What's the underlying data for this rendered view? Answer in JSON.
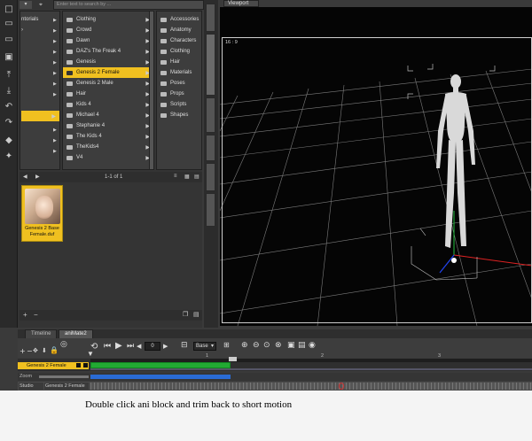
{
  "search": {
    "placeholder": "Enter text to search by ..."
  },
  "library": {
    "col1": [
      "ntorials",
      ""
    ],
    "col2": [
      "Clothing",
      "Crowd",
      "Dawn",
      "DAZ's The Freak 4",
      "Genesis",
      "Genesis 2 Female",
      "Genesis 2 Male",
      "Hair",
      "Kids 4",
      "Michael 4",
      "Stephanie 4",
      "The Kids 4",
      "TheKids4",
      "V4"
    ],
    "col2_selected": "Genesis 2 Female",
    "col3": [
      "Accessories",
      "Anatomy",
      "Characters",
      "Clothing",
      "Hair",
      "Materials",
      "Poses",
      "Props",
      "Scripts",
      "Shapes"
    ],
    "pager": "1-1 of 1",
    "thumb_label": "Genesis 2 Base Female.duf"
  },
  "side_tabs": [
    "Smart",
    "Content Library",
    "Posing",
    "Shaping",
    "Surfaces",
    "Parameters"
  ],
  "viewport": {
    "tab": "Viewport",
    "ratio": "16 : 9"
  },
  "timeline": {
    "tabs": [
      "Timeline",
      "aniMate2"
    ],
    "frame": "0",
    "base": "Base",
    "ruler": [
      "1",
      "2",
      "3"
    ],
    "track_label": "Genesis 2 Female",
    "zoom": "Zoom",
    "studio": "Studio",
    "studio_target": "Genesis 2 Female",
    "colors": {
      "accent": "#f0c020",
      "block": "#22aa33"
    }
  },
  "caption": "Double click ani block and trim back to short motion"
}
